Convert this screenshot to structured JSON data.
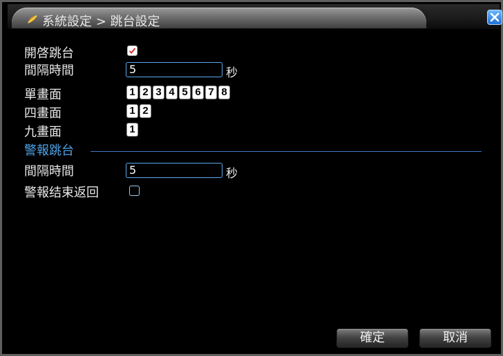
{
  "window": {
    "title": "系統設定 > 跳台設定",
    "close_icon": "close-icon"
  },
  "form": {
    "enable_label": "開啓跳台",
    "enable_checked": true,
    "interval_label": "間隔時間",
    "interval_value": "5",
    "interval_unit": "秒",
    "single_label": "單畫面",
    "single_channels": [
      "1",
      "2",
      "3",
      "4",
      "5",
      "6",
      "7",
      "8"
    ],
    "quad_label": "四畫面",
    "quad_channels": [
      "1",
      "2"
    ],
    "nine_label": "九畫面",
    "nine_channels": [
      "1"
    ]
  },
  "alarm": {
    "section_title": "警報跳台",
    "interval_label": "間隔時間",
    "interval_value": "5",
    "interval_unit": "秒",
    "return_label": "警報结束返回",
    "return_checked": false
  },
  "buttons": {
    "ok": "確定",
    "cancel": "取消"
  },
  "colors": {
    "accent": "#4fa3e8",
    "check_mark": "#d42020"
  }
}
